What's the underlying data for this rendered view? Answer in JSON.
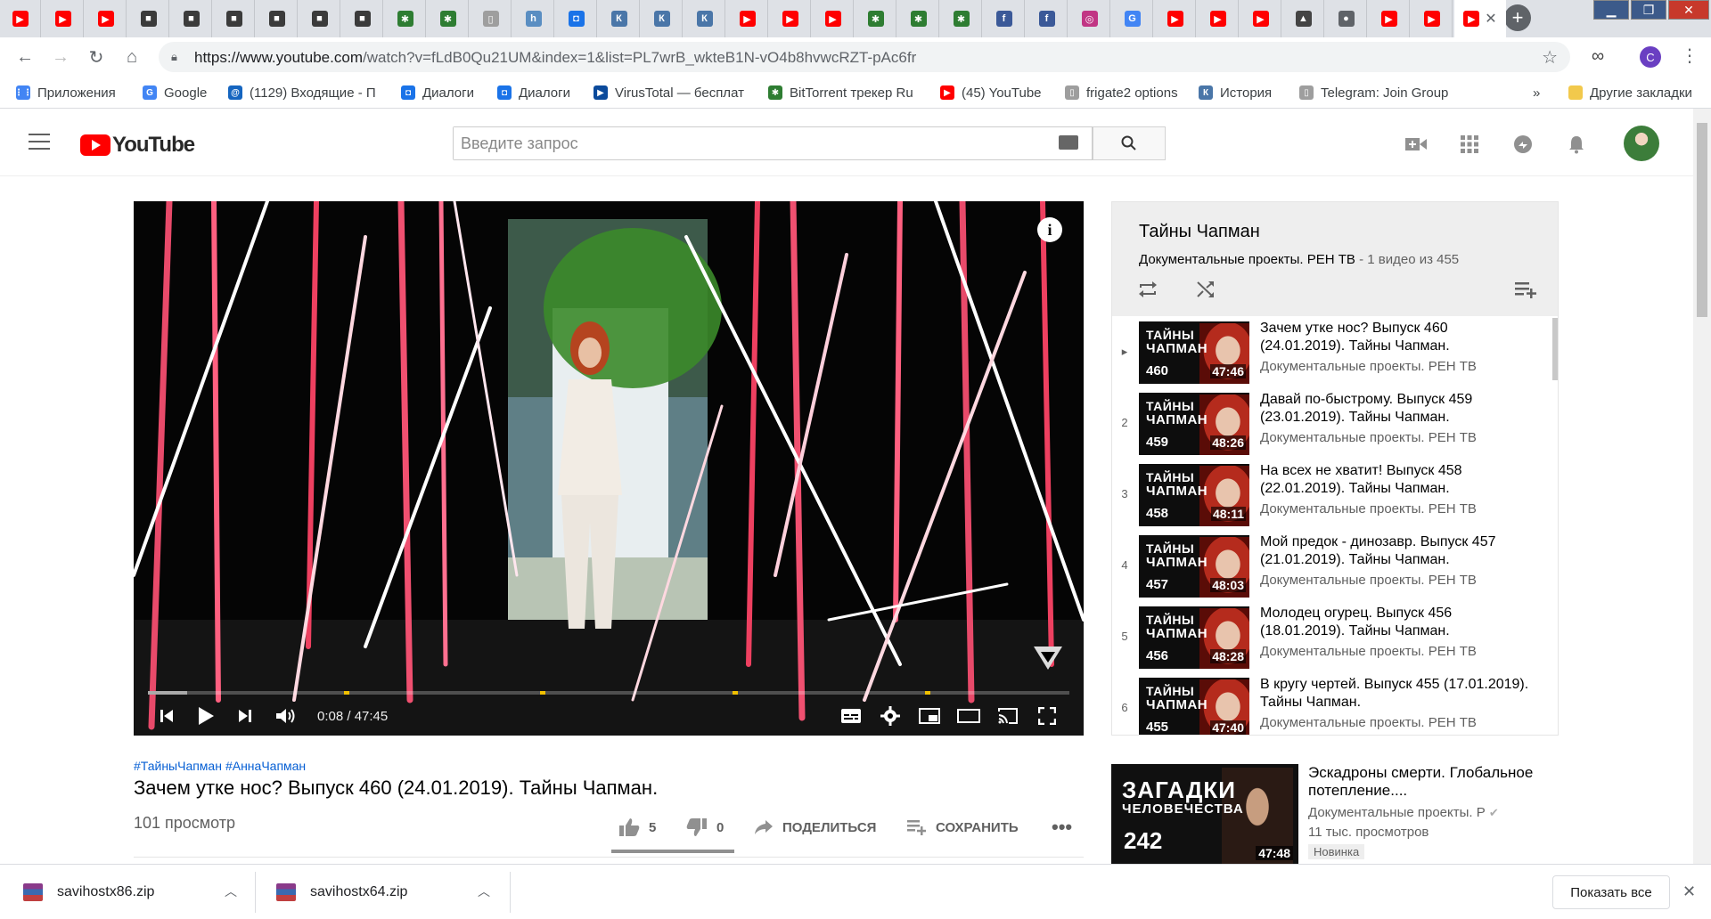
{
  "browser": {
    "url_host": "https://www.youtube.com",
    "url_path": "/watch?v=fLdB0Qu21UM&index=1&list=PL7wrB_wkteB1N-vO4b8hvwcRZT-pAc6fr",
    "profile_initial": "C",
    "active_tab_close": "✕"
  },
  "bookmarks": [
    {
      "label": "Приложения",
      "color": "#4285f4",
      "glyph": "⋮⋮"
    },
    {
      "label": "Google",
      "color": "#4285f4",
      "glyph": "G"
    },
    {
      "label": "(1129) Входящие - П",
      "color": "#1565c0",
      "glyph": "@"
    },
    {
      "label": "Диалоги",
      "color": "#1a73e8",
      "glyph": "◘"
    },
    {
      "label": "Диалоги",
      "color": "#1a73e8",
      "glyph": "◘"
    },
    {
      "label": "VirusTotal — бесплат",
      "color": "#0b4a9b",
      "glyph": "▶"
    },
    {
      "label": "BitTorrent трекер Ru",
      "color": "#2e7d32",
      "glyph": "✱"
    },
    {
      "label": "(45) YouTube",
      "color": "#ff0000",
      "glyph": "▶"
    },
    {
      "label": "frigate2 options",
      "color": "#9e9e9e",
      "glyph": "▯"
    },
    {
      "label": "История",
      "color": "#4a76a8",
      "glyph": "К"
    },
    {
      "label": "Telegram: Join Group",
      "color": "#9e9e9e",
      "glyph": "▯"
    }
  ],
  "bookmarks_more": "»",
  "bookmarks_other": "Другие закладки",
  "youtube": {
    "logo_text": "YouTube",
    "search_placeholder": "Введите запрос"
  },
  "player": {
    "time": "0:08 / 47:45",
    "progress_fraction": 0.003,
    "info_glyph": "i"
  },
  "video": {
    "hashtags": [
      "#ТайныЧапман",
      "#АннаЧапман"
    ],
    "title": "Зачем утке нос? Выпуск 460 (24.01.2019). Тайны Чапман.",
    "views": "101 просмотр",
    "likes": "5",
    "dislikes": "0",
    "share_label": "ПОДЕЛИТЬСЯ",
    "save_label": "СОХРАНИТЬ"
  },
  "playlist": {
    "title": "Тайны Чапман",
    "channel": "Документальные проекты. РЕН ТВ",
    "count": " - 1 видео из 455",
    "thumb_line1": "ТАЙНЫ",
    "thumb_line2": "ЧАПМАН",
    "items": [
      {
        "index": "▸",
        "title": "Зачем утке нос? Выпуск 460 (24.01.2019). Тайны Чапман.",
        "channel": "Документальные проекты. РЕН ТВ",
        "number": "460",
        "duration": "47:46"
      },
      {
        "index": "2",
        "title": "Давай по-быстрому. Выпуск 459 (23.01.2019). Тайны Чапман.",
        "channel": "Документальные проекты. РЕН ТВ",
        "number": "459",
        "duration": "48:26"
      },
      {
        "index": "3",
        "title": "На всех не хватит! Выпуск 458 (22.01.2019). Тайны Чапман.",
        "channel": "Документальные проекты. РЕН ТВ",
        "number": "458",
        "duration": "48:11"
      },
      {
        "index": "4",
        "title": "Мой предок - динозавр. Выпуск 457 (21.01.2019). Тайны Чапман.",
        "channel": "Документальные проекты. РЕН ТВ",
        "number": "457",
        "duration": "48:03"
      },
      {
        "index": "5",
        "title": "Молодец огурец. Выпуск 456 (18.01.2019). Тайны Чапман.",
        "channel": "Документальные проекты. РЕН ТВ",
        "number": "456",
        "duration": "48:28"
      },
      {
        "index": "6",
        "title": "В кругу чертей. Выпуск 455 (17.01.2019). Тайны Чапман.",
        "channel": "Документальные проекты. РЕН ТВ",
        "number": "455",
        "duration": "47:40"
      }
    ]
  },
  "recommendation": {
    "thumb_line1": "ЗАГАДКИ",
    "thumb_line2": "ЧЕЛОВЕЧЕСТВА",
    "thumb_number": "242",
    "duration": "47:48",
    "title": "Эскадроны смерти. Глобальное потепление....",
    "channel": "Документальные проекты. Р",
    "verified": "✔",
    "views": "11 тыс. просмотров",
    "badge": "Новинка"
  },
  "downloads": {
    "files": [
      "savihostx86.zip",
      "savihostx64.zip"
    ],
    "show_all": "Показать все",
    "close": "✕"
  },
  "tabs": [
    {
      "icon": "youtube-icon",
      "color": "#ff0000"
    },
    {
      "icon": "youtube-icon",
      "color": "#ff0000"
    },
    {
      "icon": "youtube-icon",
      "color": "#ff0000"
    },
    {
      "icon": "cube-icon",
      "color": "#3b3b3b"
    },
    {
      "icon": "cube-icon",
      "color": "#3b3b3b"
    },
    {
      "icon": "cube-icon",
      "color": "#3b3b3b"
    },
    {
      "icon": "cube-icon",
      "color": "#3b3b3b"
    },
    {
      "icon": "cube-icon",
      "color": "#3b3b3b"
    },
    {
      "icon": "cube-icon",
      "color": "#3b3b3b"
    },
    {
      "icon": "torrent-icon",
      "color": "#2e7d32"
    },
    {
      "icon": "torrent-icon",
      "color": "#2e7d32"
    },
    {
      "icon": "page-icon",
      "color": "#9e9e9e"
    },
    {
      "icon": "h-icon",
      "color": "#5a8ec2"
    },
    {
      "icon": "chat-icon",
      "color": "#1a73e8"
    },
    {
      "icon": "vk-icon",
      "color": "#4a76a8"
    },
    {
      "icon": "vk-icon",
      "color": "#4a76a8"
    },
    {
      "icon": "vk-icon",
      "color": "#4a76a8"
    },
    {
      "icon": "youtube-icon",
      "color": "#ff0000"
    },
    {
      "icon": "youtube-icon",
      "color": "#ff0000"
    },
    {
      "icon": "youtube-icon",
      "color": "#ff0000"
    },
    {
      "icon": "torrent-icon",
      "color": "#2e7d32"
    },
    {
      "icon": "torrent-icon",
      "color": "#2e7d32"
    },
    {
      "icon": "torrent-icon",
      "color": "#2e7d32"
    },
    {
      "icon": "facebook-icon",
      "color": "#3b5998"
    },
    {
      "icon": "facebook-icon",
      "color": "#3b5998"
    },
    {
      "icon": "instagram-icon",
      "color": "#c13584"
    },
    {
      "icon": "google-icon",
      "color": "#4285f4"
    },
    {
      "icon": "youtube-icon",
      "color": "#ff0000"
    },
    {
      "icon": "youtube-icon",
      "color": "#ff0000"
    },
    {
      "icon": "youtube-icon",
      "color": "#ff0000"
    },
    {
      "icon": "hood-icon",
      "color": "#444444"
    },
    {
      "icon": "circle-icon",
      "color": "#5f6368"
    },
    {
      "icon": "youtube-icon",
      "color": "#ff0000"
    },
    {
      "icon": "youtube-icon",
      "color": "#ff0000"
    }
  ]
}
